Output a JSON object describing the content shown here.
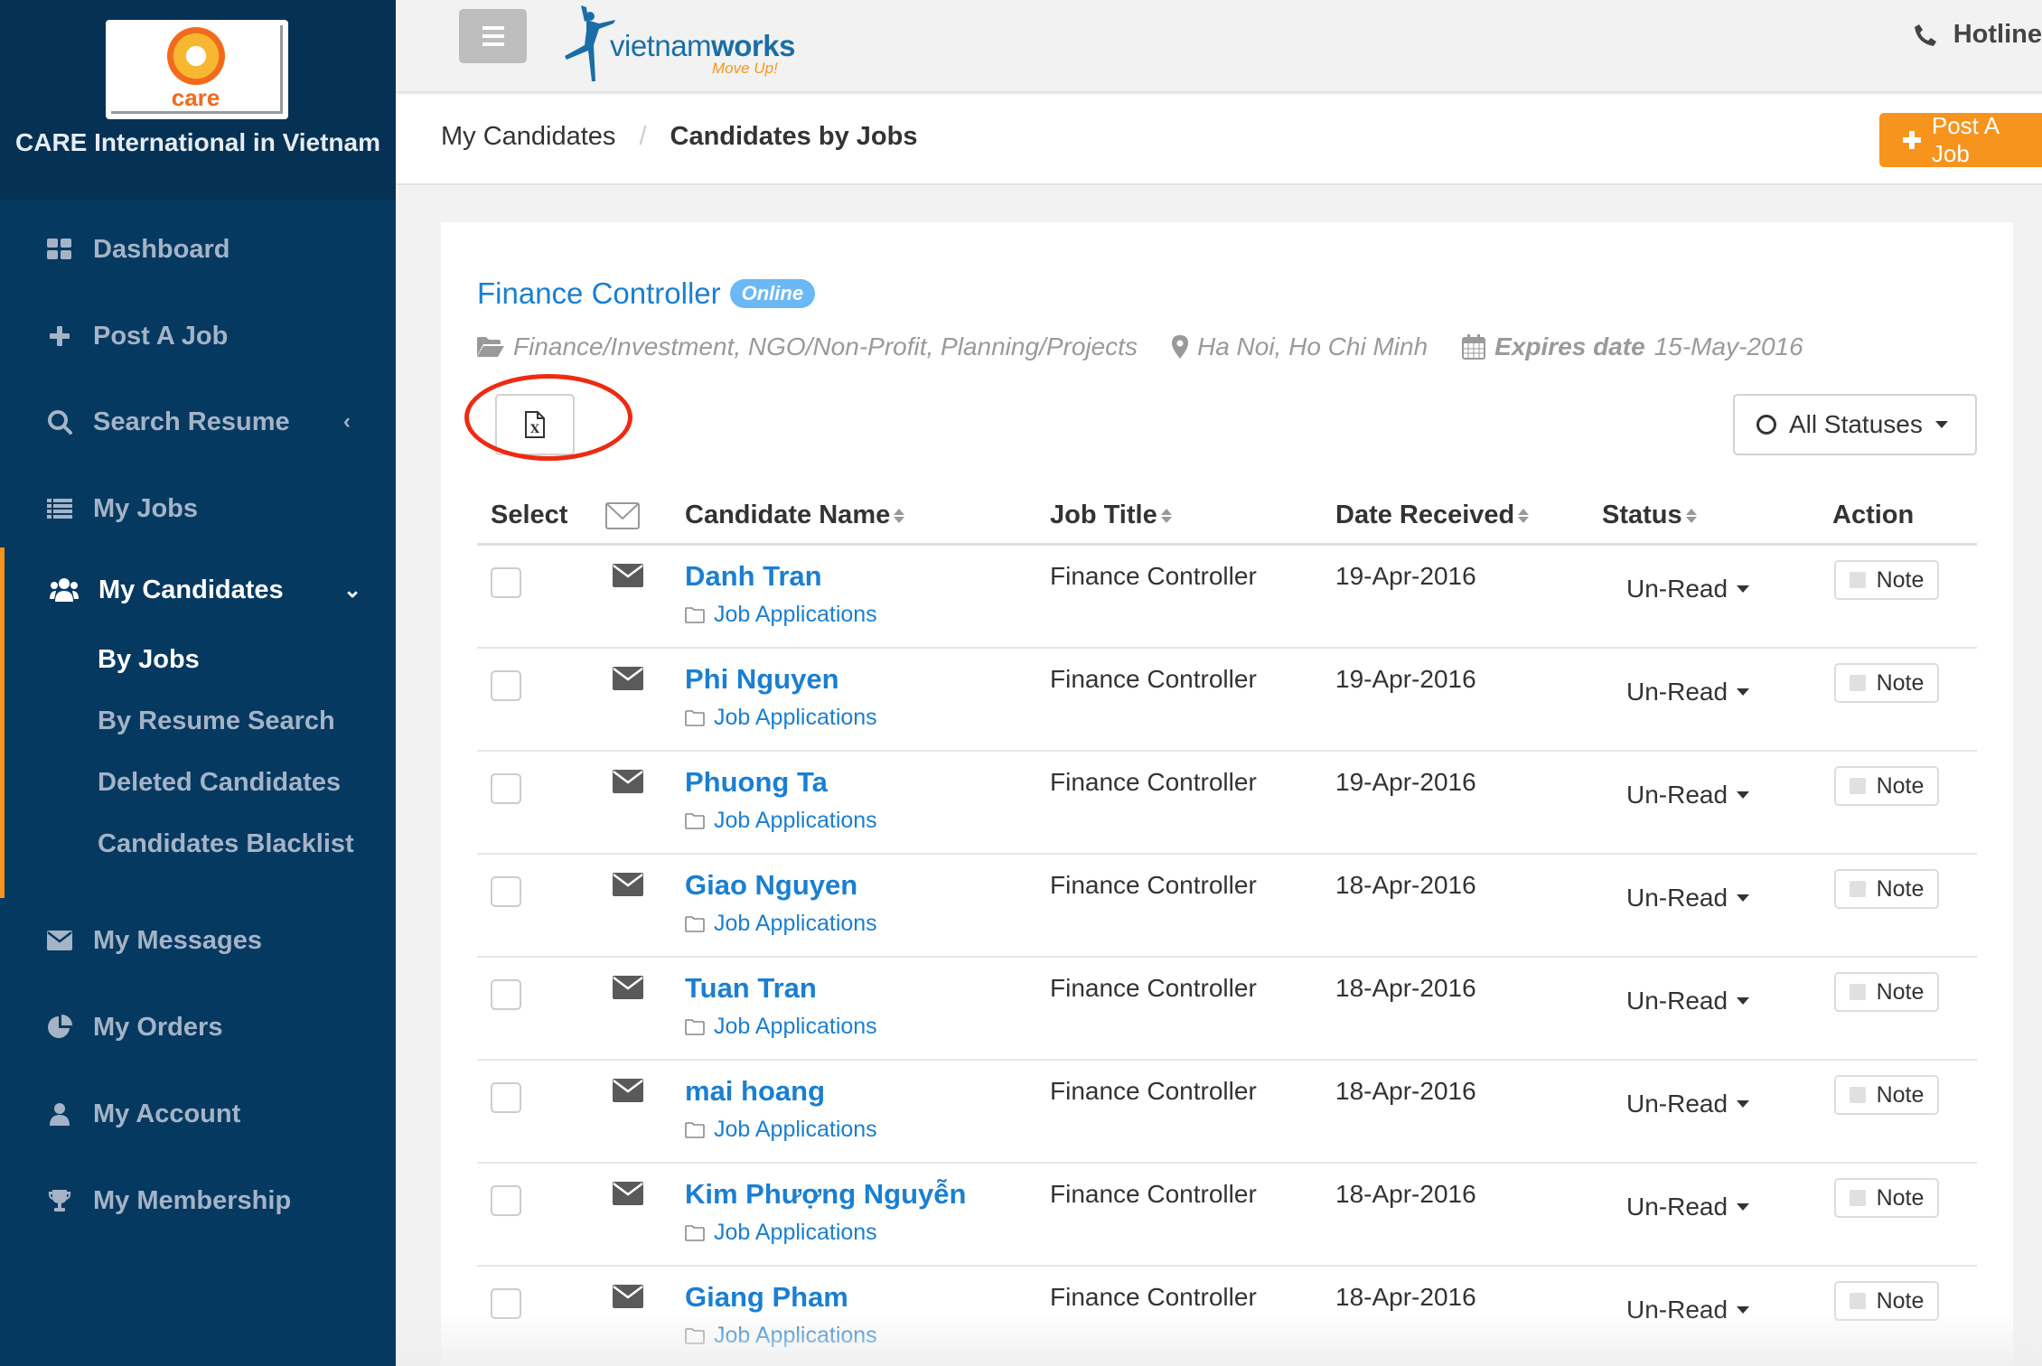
{
  "sidebar": {
    "brand_logo_text": "care",
    "brand_name": "CARE International in Vietnam",
    "items": [
      {
        "label": "Dashboard",
        "icon": "dashboard-icon"
      },
      {
        "label": "Post A Job",
        "icon": "plus-icon"
      },
      {
        "label": "Search Resume",
        "icon": "search-icon",
        "chevron": "‹"
      },
      {
        "label": "My Jobs",
        "icon": "list-icon"
      },
      {
        "label": "My Candidates",
        "icon": "users-icon",
        "chevron": "⌄",
        "active": true
      },
      {
        "label": "My Messages",
        "icon": "envelope-icon"
      },
      {
        "label": "My Orders",
        "icon": "pie-chart-icon"
      },
      {
        "label": "My Account",
        "icon": "user-icon"
      },
      {
        "label": "My Membership",
        "icon": "trophy-icon"
      }
    ],
    "sub_items": [
      {
        "label": "By Jobs",
        "active": true
      },
      {
        "label": "By Resume Search"
      },
      {
        "label": "Deleted Candidates"
      },
      {
        "label": "Candidates Blacklist"
      }
    ]
  },
  "header": {
    "logo_word_light": "vietnam",
    "logo_word_bold": "works",
    "logo_tagline": "Move Up!",
    "hotline_label": "Hotline"
  },
  "breadcrumb": {
    "parent": "My Candidates",
    "separator": "/",
    "current": "Candidates by Jobs"
  },
  "post_job_button": "Post A Job",
  "job": {
    "title": "Finance Controller",
    "badge": "Online",
    "categories": "Finance/Investment, NGO/Non-Profit, Planning/Projects",
    "locations": "Ha Noi, Ho Chi Minh",
    "expires_label": "Expires date",
    "expires_value": "15-May-2016"
  },
  "toolbar": {
    "export_excel_icon": "excel-file-icon",
    "status_filter": "All Statuses"
  },
  "table": {
    "headers": {
      "select": "Select",
      "candidate_name": "Candidate Name",
      "job_title": "Job Title",
      "date_received": "Date Received",
      "status": "Status",
      "action": "Action"
    },
    "rows": [
      {
        "name": "Danh Tran",
        "folder": "Job Applications",
        "job_title": "Finance Controller",
        "date": "19-Apr-2016",
        "status": "Un-Read",
        "action": "Note"
      },
      {
        "name": "Phi Nguyen",
        "folder": "Job Applications",
        "job_title": "Finance Controller",
        "date": "19-Apr-2016",
        "status": "Un-Read",
        "action": "Note"
      },
      {
        "name": "Phuong Ta",
        "folder": "Job Applications",
        "job_title": "Finance Controller",
        "date": "19-Apr-2016",
        "status": "Un-Read",
        "action": "Note"
      },
      {
        "name": "Giao Nguyen",
        "folder": "Job Applications",
        "job_title": "Finance Controller",
        "date": "18-Apr-2016",
        "status": "Un-Read",
        "action": "Note"
      },
      {
        "name": "Tuan Tran",
        "folder": "Job Applications",
        "job_title": "Finance Controller",
        "date": "18-Apr-2016",
        "status": "Un-Read",
        "action": "Note"
      },
      {
        "name": "mai hoang",
        "folder": "Job Applications",
        "job_title": "Finance Controller",
        "date": "18-Apr-2016",
        "status": "Un-Read",
        "action": "Note"
      },
      {
        "name": "Kim Phượng Nguyễn",
        "folder": "Job Applications",
        "job_title": "Finance Controller",
        "date": "18-Apr-2016",
        "status": "Un-Read",
        "action": "Note"
      },
      {
        "name": "Giang Pham",
        "folder": "Job Applications",
        "job_title": "Finance Controller",
        "date": "18-Apr-2016",
        "status": "Un-Read",
        "action": "Note"
      }
    ]
  },
  "colors": {
    "sidebar_bg": "#063960",
    "brand_bg": "#053154",
    "accent_orange": "#f7941d",
    "link_blue": "#1a7fd2",
    "badge_blue": "#6ab8f5",
    "annotation_red": "#ef2a12"
  }
}
